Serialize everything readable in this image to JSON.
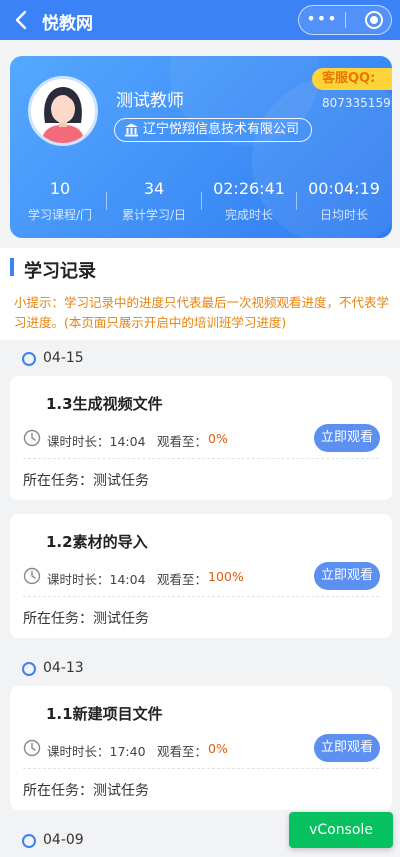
{
  "navbar": {
    "back_icon": "chevron-left-icon",
    "title": "悦教网",
    "more_icon": "more-dots-icon",
    "close_icon": "target-circle-icon",
    "color": "#3b82f6"
  },
  "profile": {
    "name": "测试教师",
    "company": "辽宁悦翔信息技术有限公司",
    "company_icon": "bank-icon",
    "qq_label": "客服QQ:",
    "qq_number": "807335159",
    "stats": [
      {
        "value": "10",
        "label": "学习课程/门"
      },
      {
        "value": "34",
        "label": "累计学习/日"
      },
      {
        "value": "02:26:41",
        "label": "完成时长"
      },
      {
        "value": "00:04:19",
        "label": "日均时长"
      }
    ]
  },
  "section": {
    "title": "学习记录",
    "tip": "小提示：学习记录中的进度只代表最后一次视频观看进度，不代表学习进度。(本页面只展示开启中的培训班学习进度)"
  },
  "records": {
    "duration_label": "课时时长：",
    "progress_label": "观看至：",
    "task_label": "所在任务：",
    "watch_button": "立即观看",
    "groups": [
      {
        "date": "04-15",
        "items": [
          {
            "title": "1.3生成视频文件",
            "duration": "14:04",
            "progress": "0%",
            "task": "测试任务"
          },
          {
            "title": "1.2素材的导入",
            "duration": "14:04",
            "progress": "100%",
            "task": "测试任务"
          }
        ]
      },
      {
        "date": "04-13",
        "items": [
          {
            "title": "1.1新建项目文件",
            "duration": "17:40",
            "progress": "0%",
            "task": "测试任务"
          }
        ]
      },
      {
        "date": "04-09",
        "items": []
      }
    ]
  },
  "vconsole": {
    "label": "vConsole",
    "color": "#07c160"
  }
}
